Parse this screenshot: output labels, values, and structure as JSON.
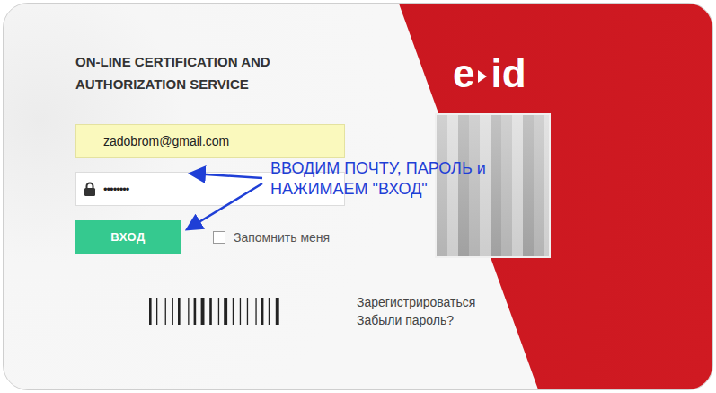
{
  "title_lines": [
    "ON-LINE CERTIFICATION AND",
    "AUTHORIZATION SERVICE"
  ],
  "email": {
    "value": "zadobrom@gmail.com",
    "autofilled": true
  },
  "password": {
    "value": "••••••••"
  },
  "login_button": {
    "label": "ВХОД"
  },
  "remember_me": {
    "label": "Запомнить меня",
    "checked": false
  },
  "links": [
    "Зарегистрироваться",
    "Забыли пароль?"
  ],
  "logo": {
    "left": "e",
    "right": "id"
  },
  "annotation": {
    "lines": [
      "ВВОДИМ ПОЧТУ, ПАРОЛЬ и",
      "НАЖИМАЕМ \"ВХОД\""
    ]
  }
}
